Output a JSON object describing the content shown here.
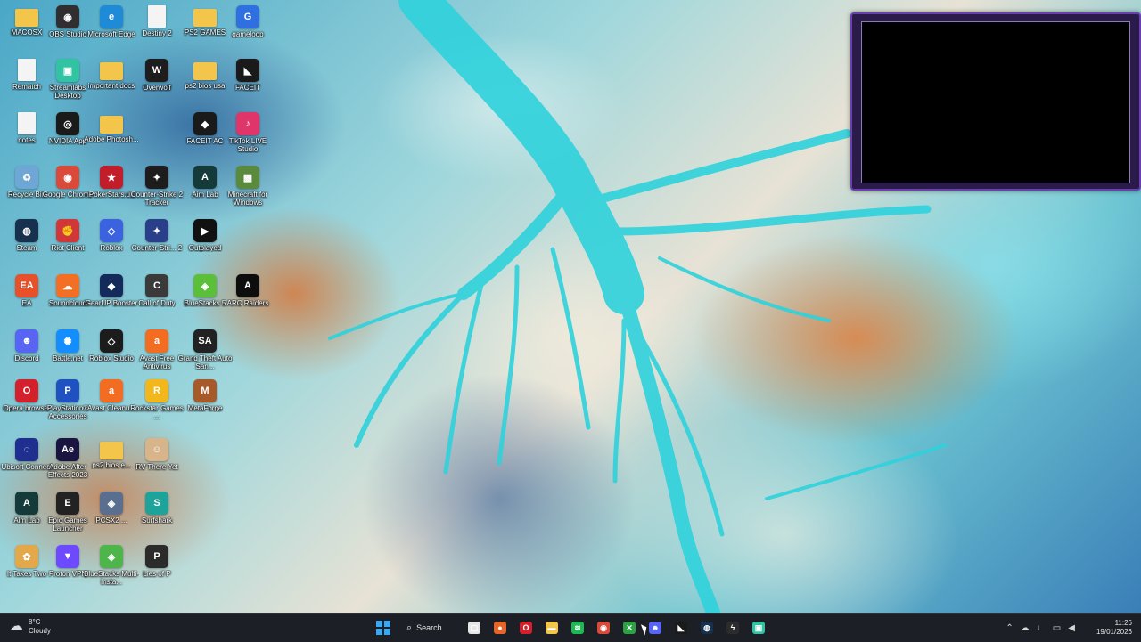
{
  "desktop": {
    "icons": [
      {
        "label": "MACOSX",
        "name": "macosx-folder-icon",
        "kind": "folder",
        "color": "#f3c64b",
        "glyph": ""
      },
      {
        "label": "OBS Studio",
        "name": "obs-studio-icon",
        "kind": "app",
        "color": "#302e31",
        "glyph": "◉"
      },
      {
        "label": "Microsoft Edge",
        "name": "microsoft-edge-icon",
        "kind": "app",
        "color": "#1f8ad6",
        "glyph": "e"
      },
      {
        "label": "Destiny 2",
        "name": "destiny-2-icon",
        "kind": "doc",
        "color": "#f4f4f4",
        "glyph": ""
      },
      {
        "label": "PS2 GAMES",
        "name": "ps2-games-folder-icon",
        "kind": "folder",
        "color": "#f3c64b",
        "glyph": ""
      },
      {
        "label": "gameloop",
        "name": "gameloop-icon",
        "kind": "app",
        "color": "#2f6fe0",
        "glyph": "G"
      },
      {
        "label": "Rematch",
        "name": "rematch-icon",
        "kind": "doc",
        "color": "#f4f4f4",
        "glyph": ""
      },
      {
        "label": "Streamlabs Desktop",
        "name": "streamlabs-desktop-icon",
        "kind": "app",
        "color": "#31c3a2",
        "glyph": "▣"
      },
      {
        "label": "important docs",
        "name": "important-docs-folder-icon",
        "kind": "folder",
        "color": "#f3c64b",
        "glyph": ""
      },
      {
        "label": "Overwolf",
        "name": "overwolf-icon",
        "kind": "app",
        "color": "#1d1d1d",
        "glyph": "W"
      },
      {
        "label": "ps2 bios usa",
        "name": "ps2-bios-usa-folder-icon",
        "kind": "folder",
        "color": "#f3c64b",
        "glyph": ""
      },
      {
        "label": "FACEIT",
        "name": "faceit-icon",
        "kind": "app",
        "color": "#1a1a1a",
        "glyph": "◣"
      },
      {
        "label": "notes",
        "name": "notes-icon",
        "kind": "doc",
        "color": "#f4f4f4",
        "glyph": ""
      },
      {
        "label": "NVIDIA App",
        "name": "nvidia-app-icon",
        "kind": "app",
        "color": "#1a1a1a",
        "glyph": "◎"
      },
      {
        "label": "Adobe Photosh...",
        "name": "adobe-photoshop-folder-icon",
        "kind": "folder",
        "color": "#f3c64b",
        "glyph": ""
      },
      {
        "label": "FACEIT AC",
        "name": "faceit-ac-icon",
        "kind": "app",
        "color": "#1a1a1a",
        "glyph": "◆"
      },
      {
        "label": "TikTok LIVE Studio",
        "name": "tiktok-live-studio-icon",
        "kind": "app",
        "color": "#e0356b",
        "glyph": "♪"
      },
      {
        "label": "Recycle Bin",
        "name": "recycle-bin-icon",
        "kind": "app",
        "color": "#6ea6d6",
        "glyph": "♻"
      },
      {
        "label": "Google Chrome",
        "name": "google-chrome-icon",
        "kind": "app",
        "color": "#d94a3a",
        "glyph": "◉"
      },
      {
        "label": "PokerStars.uk",
        "name": "pokerstars-icon",
        "kind": "app",
        "color": "#c21d2a",
        "glyph": "★"
      },
      {
        "label": "Counter-Strike 2 Tracker",
        "name": "counter-strike-2-tracker-icon",
        "kind": "app",
        "color": "#1d1d1d",
        "glyph": "✦"
      },
      {
        "label": "Aim Lab",
        "name": "aim-lab-icon",
        "kind": "app",
        "color": "#153a3a",
        "glyph": "A"
      },
      {
        "label": "Minecraft for Windows",
        "name": "minecraft-icon",
        "kind": "app",
        "color": "#5a8a3c",
        "glyph": "▩"
      },
      {
        "label": "Steam",
        "name": "steam-icon",
        "kind": "app",
        "color": "#17304e",
        "glyph": "◍"
      },
      {
        "label": "Riot Client",
        "name": "riot-client-icon",
        "kind": "app",
        "color": "#d13639",
        "glyph": "✊"
      },
      {
        "label": "Roblox",
        "name": "roblox-icon",
        "kind": "app",
        "color": "#3b63e0",
        "glyph": "◇"
      },
      {
        "label": "Counter-Stri... 2",
        "name": "counter-strike-2-icon",
        "kind": "app",
        "color": "#2a3f8a",
        "glyph": "✦"
      },
      {
        "label": "Outplayed",
        "name": "outplayed-icon",
        "kind": "app",
        "color": "#111111",
        "glyph": "▶"
      },
      {
        "label": "EA",
        "name": "ea-icon",
        "kind": "app",
        "color": "#e6502a",
        "glyph": "EA"
      },
      {
        "label": "Soundcloud",
        "name": "soundcloud-icon",
        "kind": "app",
        "color": "#f26f23",
        "glyph": "☁"
      },
      {
        "label": "GearUP Booster",
        "name": "gearup-booster-icon",
        "kind": "app",
        "color": "#142a5a",
        "glyph": "◆"
      },
      {
        "label": "Call of Duty",
        "name": "call-of-duty-icon",
        "kind": "app",
        "color": "#3a3a3a",
        "glyph": "C"
      },
      {
        "label": "BlueStacks 5",
        "name": "bluestacks-5-icon",
        "kind": "app",
        "color": "#5cbf3a",
        "glyph": "◈"
      },
      {
        "label": "ARC Raiders",
        "name": "arc-raiders-icon",
        "kind": "app",
        "color": "#0d0d0d",
        "glyph": "A"
      },
      {
        "label": "Discord",
        "name": "discord-icon",
        "kind": "app",
        "color": "#5865f2",
        "glyph": "☻"
      },
      {
        "label": "Battle.net",
        "name": "battle-net-icon",
        "kind": "app",
        "color": "#148eff",
        "glyph": "✺"
      },
      {
        "label": "Roblox Studio",
        "name": "roblox-studio-icon",
        "kind": "app",
        "color": "#1c1c1c",
        "glyph": "◇"
      },
      {
        "label": "Avast Free Antivirus",
        "name": "avast-free-antivirus-icon",
        "kind": "app",
        "color": "#f26d21",
        "glyph": "a"
      },
      {
        "label": "Grand Theft Auto San...",
        "name": "gta-san-andreas-icon",
        "kind": "app",
        "color": "#222222",
        "glyph": "SA"
      },
      {
        "label": "Opera browser",
        "name": "opera-browser-icon",
        "kind": "app",
        "color": "#d3202d",
        "glyph": "O"
      },
      {
        "label": "PlayStation® Accessories",
        "name": "playstation-accessories-icon",
        "kind": "app",
        "color": "#1f52c0",
        "glyph": "P"
      },
      {
        "label": "Avast Cleanu...",
        "name": "avast-cleanup-icon",
        "kind": "app",
        "color": "#f26d21",
        "glyph": "a"
      },
      {
        "label": "Rockstar Games ...",
        "name": "rockstar-games-icon",
        "kind": "app",
        "color": "#f2b71c",
        "glyph": "R"
      },
      {
        "label": "MetaForge",
        "name": "metaforge-icon",
        "kind": "app",
        "color": "#a65a2a",
        "glyph": "M"
      },
      {
        "label": "Ubisoft Connect",
        "name": "ubisoft-connect-icon",
        "kind": "app",
        "color": "#1f2f8f",
        "glyph": "◌"
      },
      {
        "label": "Adobe After Effects 2023",
        "name": "adobe-after-effects-icon",
        "kind": "app",
        "color": "#1a1440",
        "glyph": "Ae"
      },
      {
        "label": "ps2 bios e...",
        "name": "ps2-bios-folder-icon",
        "kind": "folder",
        "color": "#f3c64b",
        "glyph": ""
      },
      {
        "label": "RV There Yet",
        "name": "rv-there-yet-icon",
        "kind": "app",
        "color": "#d8b48a",
        "glyph": "☺"
      },
      {
        "label": "Aim Lab",
        "name": "aim-lab-2-icon",
        "kind": "app",
        "color": "#153a3a",
        "glyph": "A"
      },
      {
        "label": "Epic Games Launcher",
        "name": "epic-games-launcher-icon",
        "kind": "app",
        "color": "#222222",
        "glyph": "E"
      },
      {
        "label": "PCSX2 ...",
        "name": "pcsx2-icon",
        "kind": "app",
        "color": "#5a6f8f",
        "glyph": "◈"
      },
      {
        "label": "Surfshark",
        "name": "surfshark-icon",
        "kind": "app",
        "color": "#1ea39a",
        "glyph": "S"
      },
      {
        "label": "It Takes Two",
        "name": "it-takes-two-icon",
        "kind": "app",
        "color": "#e2a84a",
        "glyph": "✿"
      },
      {
        "label": "Proton VPN",
        "name": "proton-vpn-icon",
        "kind": "app",
        "color": "#6d4aff",
        "glyph": "▼"
      },
      {
        "label": "BlueStacks Multi-Insta...",
        "name": "bluestacks-multi-instance-icon",
        "kind": "app",
        "color": "#4eb54a",
        "glyph": "◈"
      },
      {
        "label": "Lies of P",
        "name": "lies-of-p-icon",
        "kind": "app",
        "color": "#2b2b2b",
        "glyph": "P"
      }
    ]
  },
  "taskbar": {
    "weather": {
      "temp": "8°C",
      "condition": "Cloudy"
    },
    "search_label": "Search",
    "apps": [
      {
        "name": "task-view-icon",
        "color": "#e6e6e6",
        "glyph": "▢"
      },
      {
        "name": "firefox-taskbar-icon",
        "color": "#e8652a",
        "glyph": "●"
      },
      {
        "name": "opera-taskbar-icon",
        "color": "#d3202d",
        "glyph": "O"
      },
      {
        "name": "file-explorer-taskbar-icon",
        "color": "#f3c64b",
        "glyph": "▬"
      },
      {
        "name": "spotify-taskbar-icon",
        "color": "#1db954",
        "glyph": "≋"
      },
      {
        "name": "chrome-taskbar-icon",
        "color": "#d94a3a",
        "glyph": "◉"
      },
      {
        "name": "xbox-taskbar-icon",
        "color": "#2ca243",
        "glyph": "✕"
      },
      {
        "name": "discord-taskbar-icon",
        "color": "#5865f2",
        "glyph": "☻"
      },
      {
        "name": "faceit-taskbar-icon",
        "color": "#1a1a1a",
        "glyph": "◣"
      },
      {
        "name": "steam-taskbar-icon",
        "color": "#17304e",
        "glyph": "◍"
      },
      {
        "name": "lightning-app-taskbar-icon",
        "color": "#2c2c2c",
        "glyph": "ϟ"
      },
      {
        "name": "streamlabs-taskbar-icon",
        "color": "#31c3a2",
        "glyph": "▣"
      }
    ],
    "clock": {
      "time": "11:26",
      "date": "19/01/2026"
    }
  }
}
